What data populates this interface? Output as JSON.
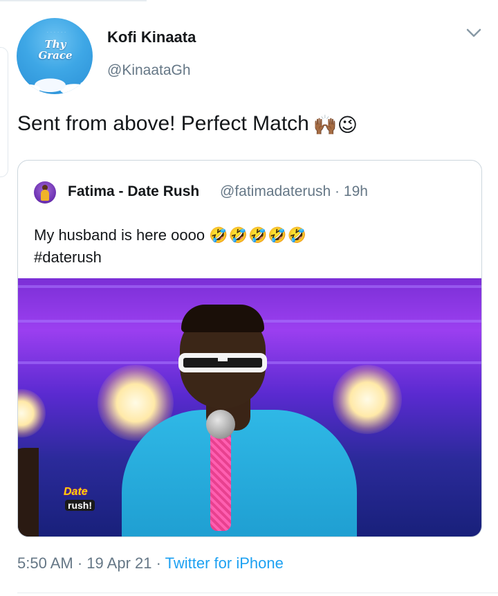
{
  "author": {
    "name": "Kofi Kinaata",
    "handle": "@KinaataGh",
    "avatar_text": "Thy Grace"
  },
  "tweet": {
    "text": "Sent from above! Perfect Match",
    "emojis": "🙌🏾😉"
  },
  "quoted": {
    "name": "Fatima - Date Rush",
    "handle": "@fatimadaterush · 19h",
    "text_line1": "My husband is here oooo",
    "text_line1_emojis": "🤣🤣🤣🤣🤣",
    "text_line2": "#daterush",
    "image_logo_top": "Date",
    "image_logo_bottom": "rush!"
  },
  "meta": {
    "time": "5:50 AM",
    "separator": "·",
    "date": "19 Apr 21",
    "source": "Twitter for iPhone"
  },
  "icons": {
    "menu": "chevron-down-icon"
  },
  "colors": {
    "link": "#1da1f2",
    "secondary_text": "#657786",
    "primary_text": "#14171a",
    "border": "#ccd6dd"
  }
}
